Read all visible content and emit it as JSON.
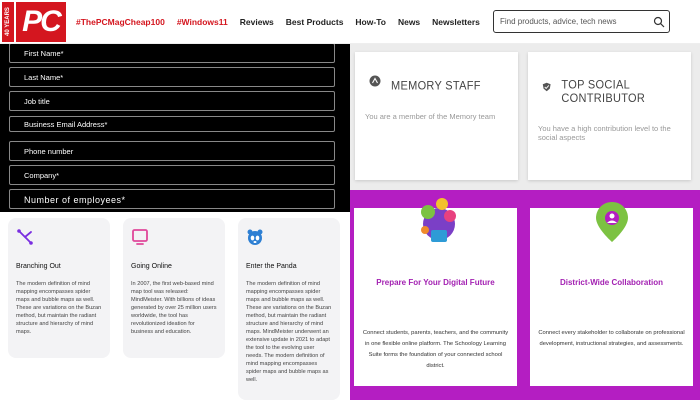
{
  "header": {
    "logo": {
      "years": "40 YEARS",
      "text": "PC"
    },
    "nav": [
      {
        "label": "#ThePCMagCheap100",
        "hot": true
      },
      {
        "label": "#Windows11",
        "hot": true
      },
      {
        "label": "Reviews",
        "hot": false
      },
      {
        "label": "Best Products",
        "hot": false
      },
      {
        "label": "How-To",
        "hot": false
      },
      {
        "label": "News",
        "hot": false
      },
      {
        "label": "Newsletters",
        "hot": false
      }
    ],
    "search": {
      "placeholder": "Find products, advice, tech news"
    }
  },
  "form": {
    "fields": [
      "First Name*",
      "Last Name*",
      "Job title",
      "Business Email Address*",
      "Phone number",
      "Company*",
      "Number of employees*"
    ]
  },
  "mindmap_cards": [
    {
      "icon": "branch-icon",
      "title": "Branching Out",
      "body": "The modern definition of mind mapping encompasses spider maps and bubble maps as well. These are variations on the Buzan method, but maintain the radiant structure and hierarchy of mind maps."
    },
    {
      "icon": "monitor-icon",
      "title": "Going Online",
      "body": "In 2007, the first web-based mind map tool was released: MindMeister. With billions of ideas generated by over 25 million users worldwide, the tool has revolutionized ideation for business and education."
    },
    {
      "icon": "panda-icon",
      "title": "Enter the Panda",
      "body": "The modern definition of mind mapping encompasses spider maps and bubble maps as well. These are variations on the Buzan method, but maintain the radiant structure and hierarchy of mind maps. MindMeister underwent an extensive update in 2021 to adapt the tool to the evolving user needs. The modern definition of mind mapping encompasses spider maps and bubble maps as well."
    }
  ],
  "badges": [
    {
      "icon": "memory-badge-icon",
      "title": "MEMORY STAFF",
      "text": "You are a member of the Memory team"
    },
    {
      "icon": "check-shield-icon",
      "title": "TOP SOCIAL CONTRIBUTOR",
      "text": "You have a high contribution level to the social aspects"
    }
  ],
  "purple_cards": [
    {
      "title": "Prepare For Your Digital Future",
      "body": "Connect students, parents, teachers, and the community in one flexible online platform. The Schoology Learning Suite forms the foundation of your connected school district."
    },
    {
      "title": "District-Wide Collaboration",
      "body": "Connect every stakeholder to collaborate on professional development, instructional strategies, and assessments."
    }
  ],
  "colors": {
    "pcmag_red": "#d4161f",
    "purple_bg": "#b41ec2",
    "purple_title": "#a321b2",
    "mm_card_bg": "#f3f3f5"
  }
}
